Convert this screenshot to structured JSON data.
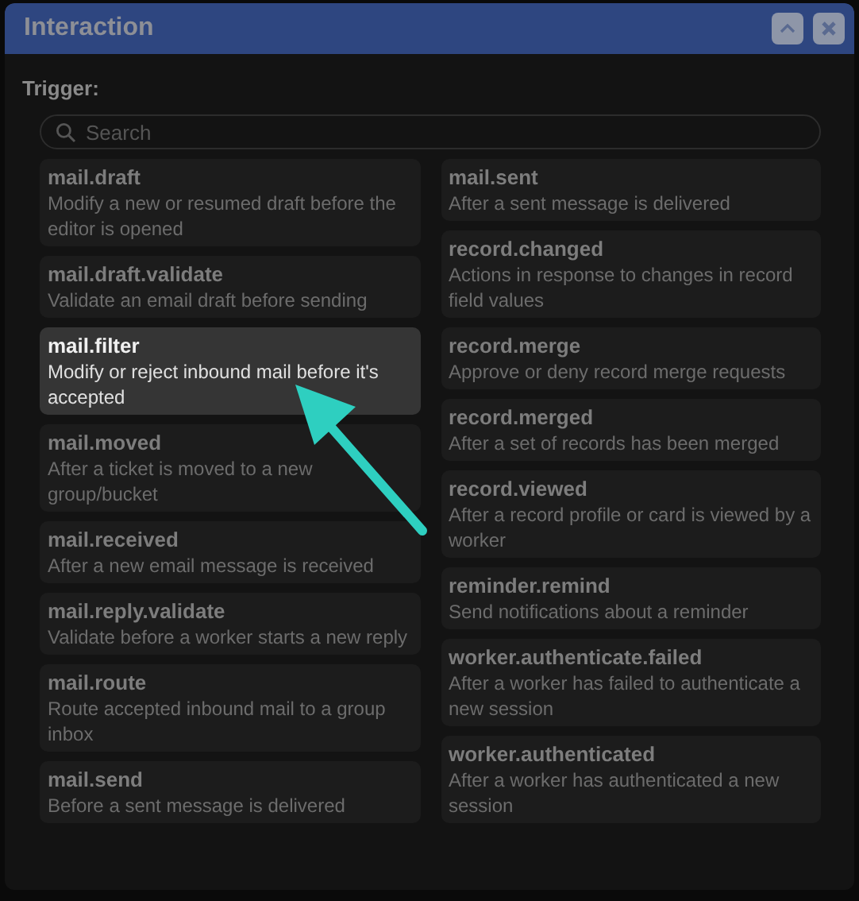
{
  "window": {
    "title": "Interaction"
  },
  "trigger": {
    "label": "Trigger:",
    "search": {
      "placeholder": "Search"
    }
  },
  "columns": [
    [
      {
        "name": "mail.draft",
        "description": "Modify a new or resumed draft before the editor is opened",
        "selected": false
      },
      {
        "name": "mail.draft.validate",
        "description": "Validate an email draft before sending",
        "selected": false
      },
      {
        "name": "mail.filter",
        "description": "Modify or reject inbound mail before it's accepted",
        "selected": true
      },
      {
        "name": "mail.moved",
        "description": "After a ticket is moved to a new group/bucket",
        "selected": false
      },
      {
        "name": "mail.received",
        "description": "After a new email message is received",
        "selected": false
      },
      {
        "name": "mail.reply.validate",
        "description": "Validate before a worker starts a new reply",
        "selected": false
      },
      {
        "name": "mail.route",
        "description": "Route accepted inbound mail to a group inbox",
        "selected": false
      },
      {
        "name": "mail.send",
        "description": "Before a sent message is delivered",
        "selected": false
      }
    ],
    [
      {
        "name": "mail.sent",
        "description": "After a sent message is delivered",
        "selected": false
      },
      {
        "name": "record.changed",
        "description": "Actions in response to changes in record field values",
        "selected": false
      },
      {
        "name": "record.merge",
        "description": "Approve or deny record merge requests",
        "selected": false
      },
      {
        "name": "record.merged",
        "description": "After a set of records has been merged",
        "selected": false
      },
      {
        "name": "record.viewed",
        "description": "After a record profile or card is viewed by a worker",
        "selected": false
      },
      {
        "name": "reminder.remind",
        "description": "Send notifications about a reminder",
        "selected": false
      },
      {
        "name": "worker.authenticate.failed",
        "description": "After a worker has failed to authenticate a new session",
        "selected": false
      },
      {
        "name": "worker.authenticated",
        "description": "After a worker has authenticated a new session",
        "selected": false
      }
    ]
  ]
}
